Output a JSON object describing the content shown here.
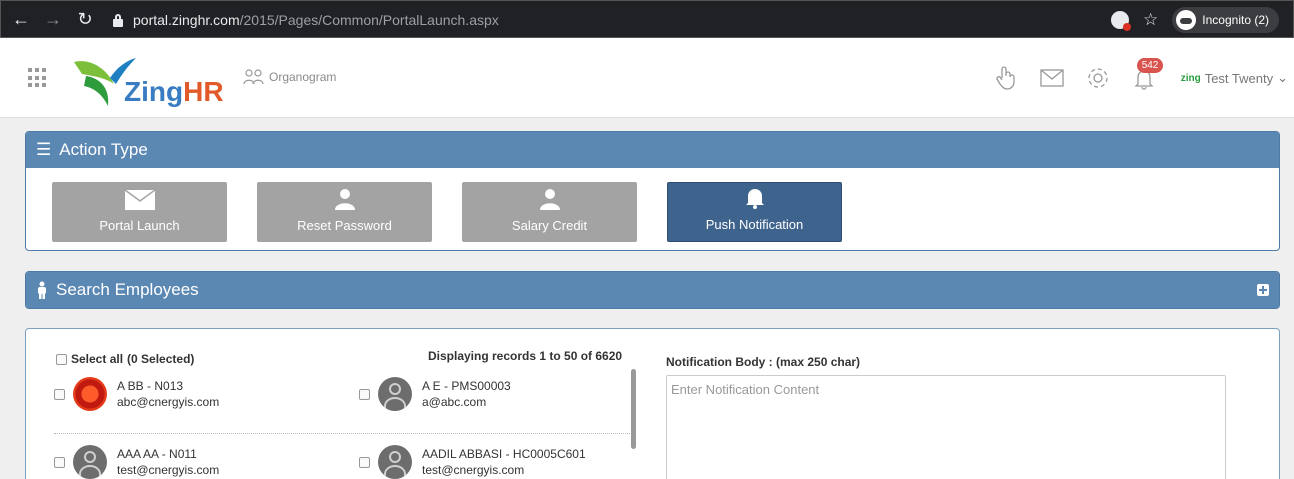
{
  "browser": {
    "url_host": "portal.zinghr.com",
    "url_path": "/2015/Pages/Common/PortalLaunch.aspx",
    "incognito_label": "Incognito (2)"
  },
  "header": {
    "logo": "ZingHR",
    "logo_zing": "Zing",
    "logo_hr": "HR",
    "organogram": "Organogram",
    "notifications_count": "542",
    "user_brand": "zing",
    "user_name": "Test Twenty"
  },
  "action_type": {
    "title": "Action Type",
    "buttons": [
      {
        "label": "Portal Launch",
        "icon": "envelope-icon",
        "active": false
      },
      {
        "label": "Reset Password",
        "icon": "user-icon",
        "active": false
      },
      {
        "label": "Salary Credit",
        "icon": "user-icon",
        "active": false
      },
      {
        "label": "Push Notification",
        "icon": "bell-icon",
        "active": true
      }
    ]
  },
  "search": {
    "title": "Search Employees"
  },
  "employees": {
    "select_all": "Select all",
    "selected_count": "(0 Selected)",
    "displaying": "Displaying records 1 to 50 of 6620",
    "list": [
      {
        "name": "A BB - N013",
        "email": "abc@cnergyis.com"
      },
      {
        "name": "A E - PMS00003",
        "email": "a@abc.com"
      },
      {
        "name": "AAA AA - N011",
        "email": "test@cnergyis.com"
      },
      {
        "name": "AADIL ABBASI - HC0005C601",
        "email": "test@cnergyis.com"
      }
    ]
  },
  "notification": {
    "label": "Notification Body : (max 250 char)",
    "placeholder": "Enter Notification Content"
  },
  "colors": {
    "panel_header": "#5b87b3",
    "active_button": "#3e638c",
    "inactive_button": "#a3a3a3",
    "badge": "#d9534f"
  }
}
